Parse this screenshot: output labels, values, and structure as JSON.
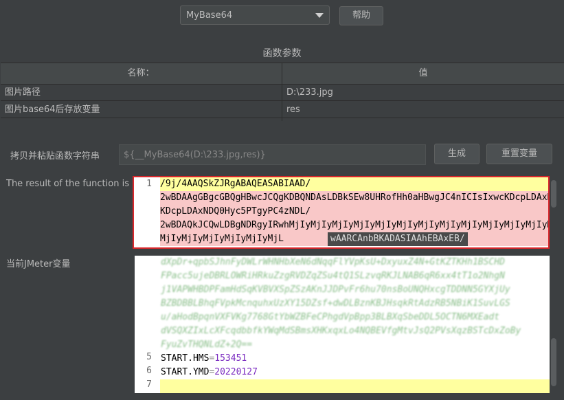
{
  "toolbar": {
    "function_select": "MyBase64",
    "help_label": "帮助"
  },
  "params": {
    "title": "函数参数",
    "col_name": "名称：",
    "col_value": "值",
    "rows": [
      {
        "name": "图片路径",
        "value": "D:\\233.jpg"
      },
      {
        "name": "图片base64后存放变量",
        "value": "res"
      }
    ]
  },
  "copy_paste": {
    "label": "拷贝并粘贴函数字符串",
    "placeholder": "${__MyBase64(D:\\233.jpg,res)}",
    "generate_label": "生成",
    "reset_label": "重置变量"
  },
  "result": {
    "label": "The result of the function is",
    "lines": [
      "/9j/4AAQSkZJRgABAQEASABIAAD/",
      "2wBDAAgGBgcGBQgHBwcJCQgKDBQNDAsLDBkSEw8UHRofHh0aHBwgJC4nICIsIxwcKDcpLDAxNDQ0Hyc5PTgyPC4zNDL/",
      "KDcpLDAxNDQ0Hyc5PTgyPC4zNDL/",
      "2wBDAQkJCQwLDBgNDRgyIRwhMjIyMjIyMjIyMjIyMjIyMjIyMjIyMjIyMjIyMjIyMjIyMjIyMjIyMjIyMjIyMjIyMjIyMjL/",
      "MjIyMjIyMjIyMjIyMjIyMjL",
      "wAARCAnbBKADASIAAhEBAxEB/"
    ],
    "line_number": "1"
  },
  "variables": {
    "label": "当前JMeter变量",
    "blur_lines": [
      "dXpDr+qpbSJhnFyDWLrWHNHbXeN6dNqqFlYVpKsU+DxyuxZ4N+GtKZTKHh1BSCHD",
      "FPacc5ujeDBRLOWRiHRkuZzgRVDZqZSu4tQ1SLzvqRKJLNAB6qR6xx4tT1o2NhgN",
      "j1VAPWHBDPFamHdSqKVBVXSpZSzAKnJJDPvFr6hu70nsBoUNQHxcgTDDNN5GYXjUy",
      "BZBDBBLBhqFVpkMcnquhxUzXY15DZsf+dwDLBznKBJHsqkRtAdzRB5NBiK1SuvLGS",
      "u/aHodBpqnVXFVKg7768GtYbWZBFeCPhgdVpBpp3BLBXqSbeDDL5OCTN6MXEadt",
      "dVSQXZIxLcXFcqdbbfkYWqMdSBmsXHKxqxLo4NQBEVfgMtvJsQ2PVsXqzBSTcDxZoBy",
      "FyuZvTHQNLdZ+2Q=="
    ],
    "entries": [
      {
        "ln": "5",
        "key": "START.HMS",
        "sep": "=",
        "value": "153451"
      },
      {
        "ln": "6",
        "key": "START.YMD",
        "sep": "=",
        "value": "20220127"
      },
      {
        "ln": "7",
        "key": "",
        "sep": "",
        "value": ""
      }
    ]
  },
  "colors": {
    "background": "#3c3f41",
    "result_border": "#d9262b",
    "yellow_highlight": "#ffff9f",
    "pink_highlight": "#f9c8c8",
    "selection_gray": "#4a4a4a",
    "value_purple": "#7a2bc0",
    "blur_green": "#2a8a2a"
  }
}
